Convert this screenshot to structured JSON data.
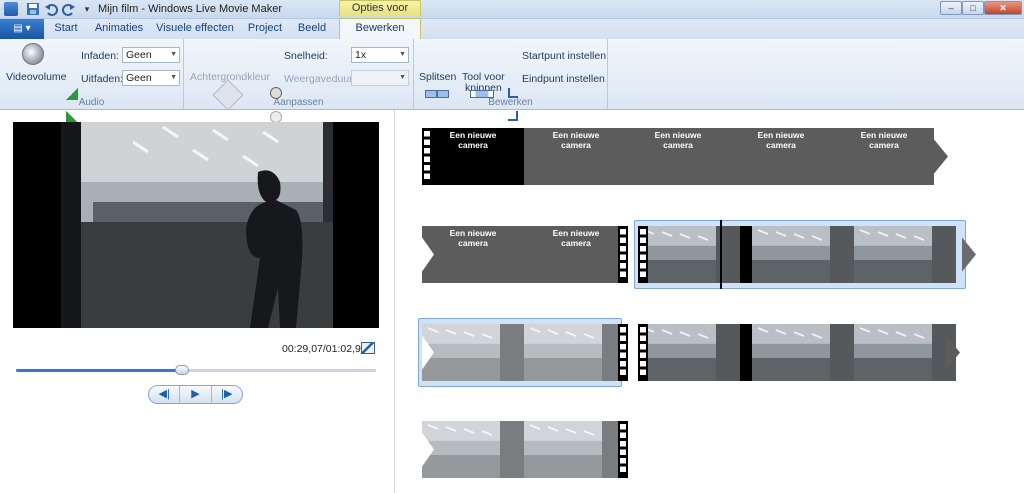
{
  "window": {
    "title": "Mijn film - Windows Live Movie Maker",
    "context_label": "Opties voor video",
    "min": "–",
    "max": "□",
    "close": "✕"
  },
  "quick_access": {
    "more": "▾"
  },
  "app_menu": {
    "label": "▤ ▾"
  },
  "tabs": [
    "Start",
    "Animaties",
    "Visuele effecten",
    "Project",
    "Beeld",
    "Bewerken"
  ],
  "ribbon": {
    "audio": {
      "label": "Audio",
      "videovolume": "Videovolume",
      "fade_in_label": "Infaden:",
      "fade_in_value": "Geen",
      "fade_out_label": "Uitfaden:",
      "fade_out_value": "Geen"
    },
    "aanpassen": {
      "label": "Aanpassen",
      "background": "Achtergrondkleur",
      "speed_label": "Snelheid:",
      "speed_value": "1x",
      "duration_label": "Weergaveduur:",
      "duration_value": ""
    },
    "bewerken": {
      "label": "Bewerken",
      "split": "Splitsen",
      "trim_line1": "Tool voor",
      "trim_line2": "knippen",
      "set_start": "Startpunt instellen",
      "set_end": "Eindpunt instellen"
    }
  },
  "preview": {
    "time": "00:29,07/01:02,97",
    "progress": 0.46
  },
  "playback": {
    "prev": "◀|",
    "play": "▶",
    "next": "|▶"
  },
  "storyboard": {
    "caption": "Een nieuwe camera",
    "caption_line1": "Een nieuwe",
    "caption_line2": "camera"
  }
}
